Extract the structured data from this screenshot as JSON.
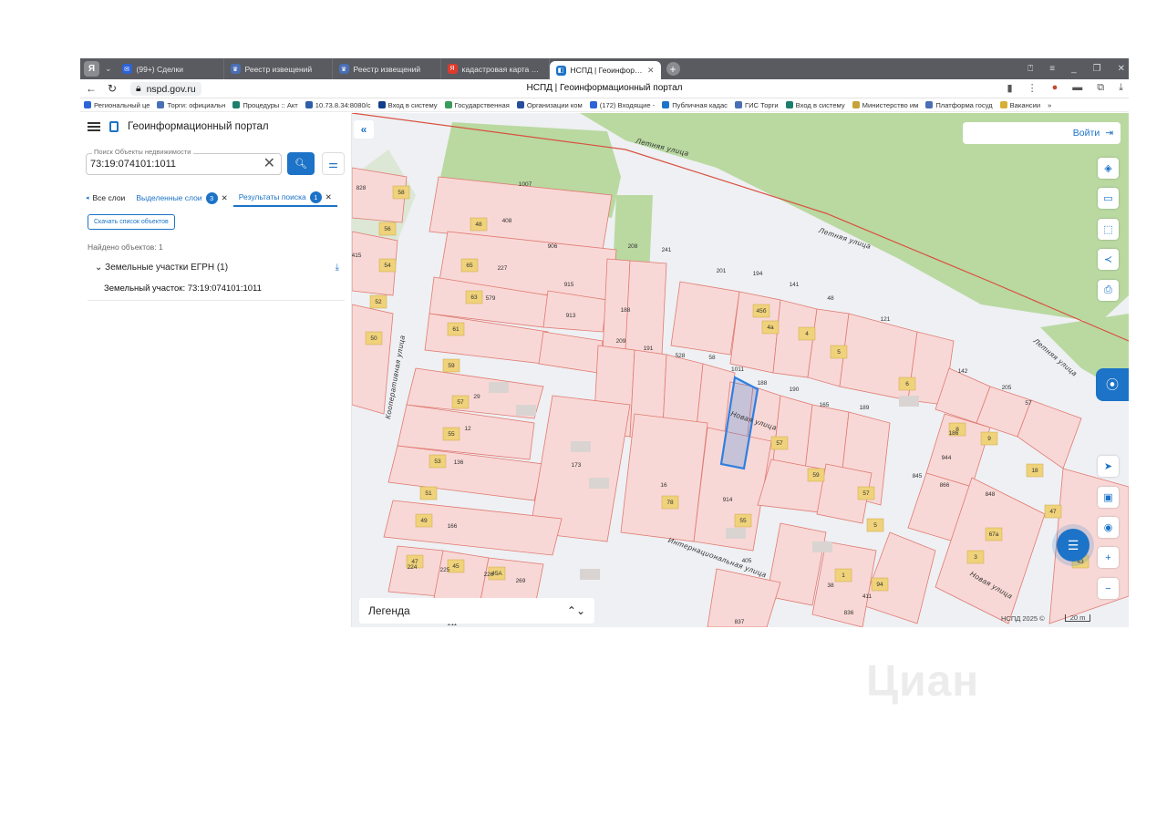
{
  "colors": {
    "accent": "#1c73c7",
    "tab_bar": "#595b60",
    "parcel_fill": "#f8d8d6",
    "parcel_border": "#e07a72",
    "building": "#efd27a",
    "green": "#b9d9a1",
    "highlight": "#2f7fe0"
  },
  "browser": {
    "tabs": [
      {
        "label": "(99+) Сделки",
        "icon": "mail-icon",
        "icon_color": "#2d63d8"
      },
      {
        "label": "Реестр извещений",
        "icon": "emblem-icon",
        "icon_color": "#4a6fb5"
      },
      {
        "label": "Реестр извещений",
        "icon": "emblem-icon",
        "icon_color": "#4a6fb5"
      },
      {
        "label": "кадастровая карта — Янд",
        "icon": "yandex-icon",
        "icon_color": "#e0392b"
      },
      {
        "label": "НСПД | Геоинформаци",
        "icon": "nspd-icon",
        "icon_color": "#1c73c7",
        "active": true
      }
    ],
    "url": "nspd.gov.ru",
    "page_title": "НСПД | Геоинформационный портал",
    "bookmarks": [
      {
        "label": "Региональный це",
        "color": "#2d63d8"
      },
      {
        "label": "Торги: официальн",
        "color": "#4a6fb5"
      },
      {
        "label": "Процедуры :: Акт",
        "color": "#1c7f6b"
      },
      {
        "label": "10.73.8.34:8080/c",
        "color": "#2f5fa8"
      },
      {
        "label": "Вход в систему",
        "color": "#123f8a"
      },
      {
        "label": "Государственная",
        "color": "#3a9b5c"
      },
      {
        "label": "Организации ком",
        "color": "#264d9b"
      },
      {
        "label": "(172) Входящие -",
        "color": "#2d63d8"
      },
      {
        "label": "Публичная кадас",
        "color": "#1c73c7"
      },
      {
        "label": "ГИС Торги",
        "color": "#4a6fb5"
      },
      {
        "label": "Вход в систему",
        "color": "#1c7f6b"
      },
      {
        "label": "Министерство им",
        "color": "#c7a23a"
      },
      {
        "label": "Платформа госуд",
        "color": "#4a6fb5"
      },
      {
        "label": "Вакансии",
        "color": "#d6b036"
      }
    ],
    "bookmarks_more": "»"
  },
  "panel": {
    "title": "Геоинформационный портал",
    "search_label": "Поиск Объекты недвижимости",
    "search_value": "73:19:074101:1011",
    "tabs": [
      {
        "label": "Все слои"
      },
      {
        "label": "Выделенные слои",
        "badge": "3"
      },
      {
        "label": "Результаты поиска",
        "badge": "1"
      }
    ],
    "download_label": "Скачать список объектов",
    "found_label": "Найдено объектов: 1",
    "group_label": "Земельные участки ЕГРН (1)",
    "result_item": "Земельный участок: 73:19:074101:1011"
  },
  "map": {
    "login_label": "Войти",
    "legend_label": "Легенда",
    "copyright": "НСПД 2025 ©",
    "scale": "20 m",
    "streets": [
      "Летняя улица",
      "Летняя улица",
      "Летняя улица",
      "Новая улица",
      "Новая улица",
      "Интернациональная улица",
      "Кооперативная улица"
    ],
    "parcel_numbers": [
      "1007",
      "408",
      "906",
      "227",
      "915",
      "579",
      "913",
      "208",
      "241",
      "201",
      "194",
      "141",
      "48",
      "121",
      "188",
      "209",
      "191",
      "528",
      "58",
      "1011",
      "188",
      "190",
      "165",
      "189",
      "29",
      "12",
      "136",
      "173",
      "16",
      "914",
      "405",
      "166",
      "224",
      "225",
      "226",
      "269",
      "142",
      "205",
      "57",
      "186",
      "944",
      "845",
      "866",
      "848",
      "38",
      "411",
      "836",
      "837",
      "828",
      "415",
      "211",
      "908"
    ],
    "building_numbers": [
      "58",
      "56",
      "54",
      "52",
      "50",
      "48",
      "65",
      "63",
      "61",
      "59",
      "57",
      "55",
      "53",
      "51",
      "49",
      "47",
      "45",
      "45А",
      "45б",
      "4а",
      "4",
      "5",
      "6",
      "8",
      "9",
      "18",
      "57",
      "59",
      "57",
      "5",
      "3",
      "1",
      "94",
      "78",
      "55",
      "67а",
      "47",
      "43",
      "74",
      "72"
    ]
  },
  "watermark": "Циан"
}
